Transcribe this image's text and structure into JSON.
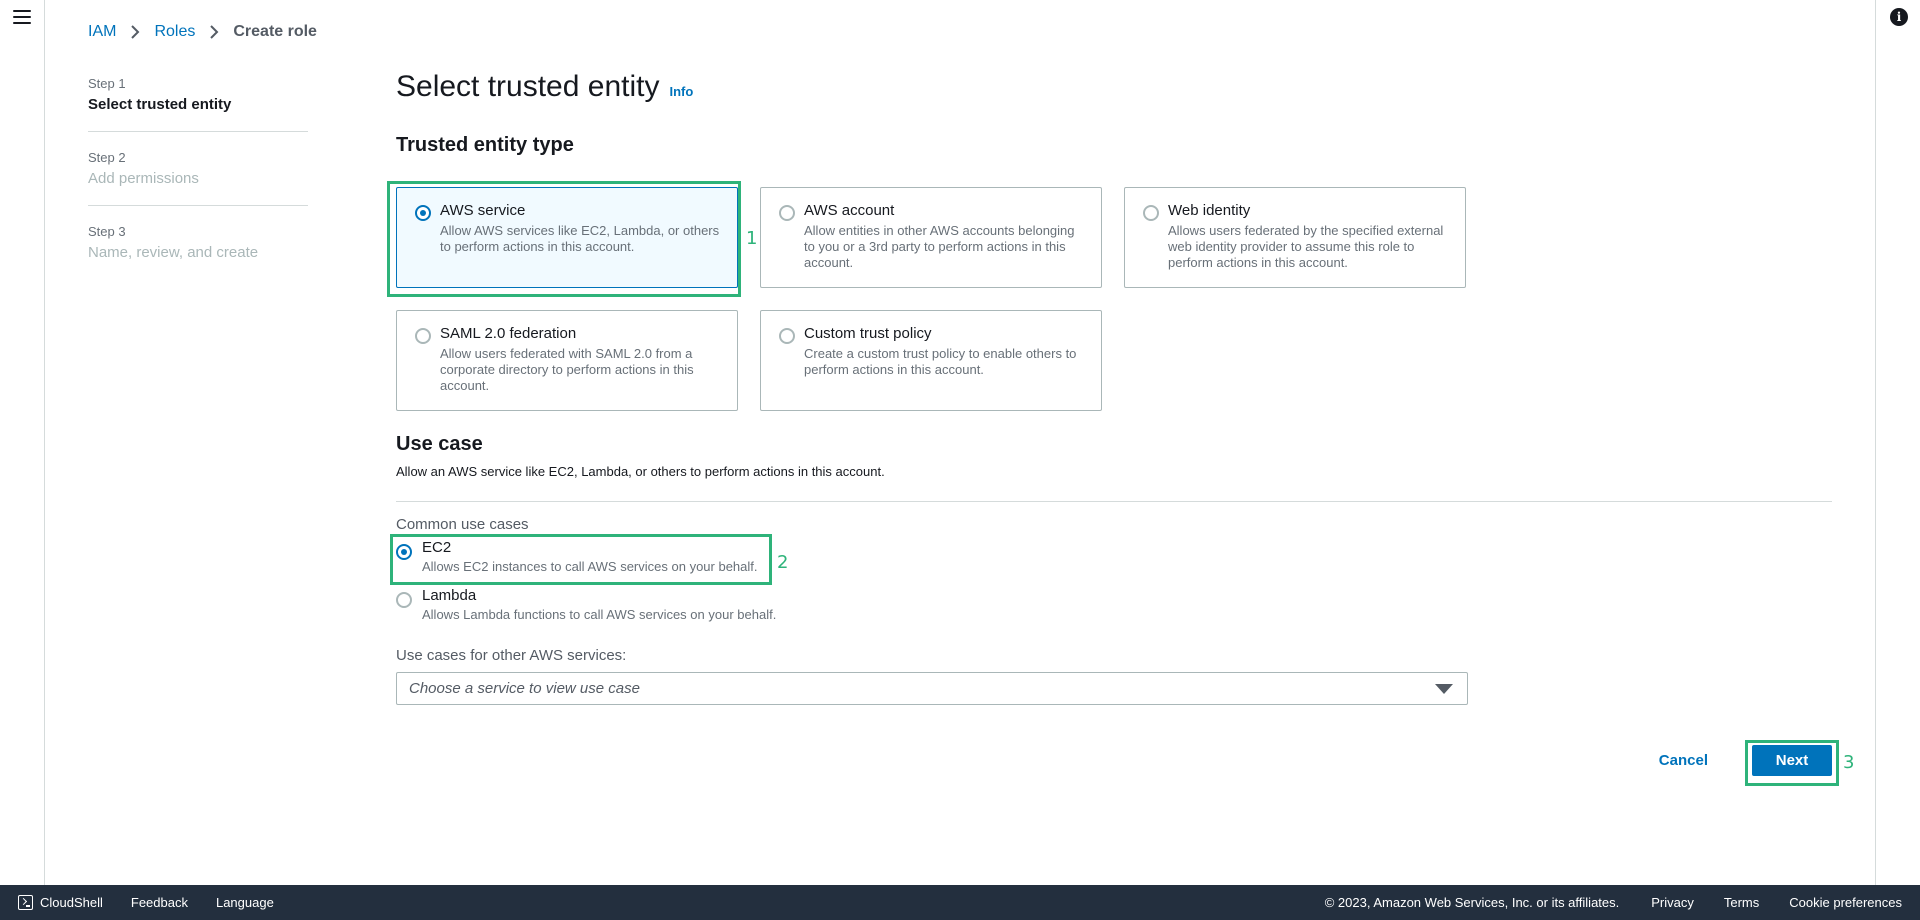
{
  "breadcrumb": {
    "items": [
      "IAM",
      "Roles"
    ],
    "current": "Create role"
  },
  "steps": [
    {
      "num": "Step 1",
      "title": "Select trusted entity",
      "active": true
    },
    {
      "num": "Step 2",
      "title": "Add permissions",
      "active": false
    },
    {
      "num": "Step 3",
      "title": "Name, review, and create",
      "active": false
    }
  ],
  "main": {
    "title": "Select trusted entity",
    "info": "Info",
    "trusted_entity_type": {
      "title": "Trusted entity type",
      "tiles": [
        {
          "title": "AWS service",
          "desc": "Allow AWS services like EC2, Lambda, or others to perform actions in this account.",
          "selected": true
        },
        {
          "title": "AWS account",
          "desc": "Allow entities in other AWS accounts belonging to you or a 3rd party to perform actions in this account.",
          "selected": false
        },
        {
          "title": "Web identity",
          "desc": "Allows users federated by the specified external web identity provider to assume this role to perform actions in this account.",
          "selected": false
        },
        {
          "title": "SAML 2.0 federation",
          "desc": "Allow users federated with SAML 2.0 from a corporate directory to perform actions in this account.",
          "selected": false
        },
        {
          "title": "Custom trust policy",
          "desc": "Create a custom trust policy to enable others to perform actions in this account.",
          "selected": false
        }
      ]
    },
    "use_case": {
      "title": "Use case",
      "desc": "Allow an AWS service like EC2, Lambda, or others to perform actions in this account.",
      "common_label": "Common use cases",
      "options": [
        {
          "title": "EC2",
          "desc": "Allows EC2 instances to call AWS services on your behalf.",
          "selected": true
        },
        {
          "title": "Lambda",
          "desc": "Allows Lambda functions to call AWS services on your behalf.",
          "selected": false
        }
      ],
      "other_label": "Use cases for other AWS services:",
      "select_placeholder": "Choose a service to view use case"
    },
    "cancel_label": "Cancel",
    "next_label": "Next"
  },
  "annotations": [
    "1",
    "2",
    "3"
  ],
  "footer": {
    "cloudshell": "CloudShell",
    "feedback": "Feedback",
    "language": "Language",
    "copyright": "© 2023, Amazon Web Services, Inc. or its affiliates.",
    "privacy": "Privacy",
    "terms": "Terms",
    "cookies": "Cookie preferences"
  },
  "colors": {
    "link": "#0073bb",
    "highlight": "#2eb37a",
    "footer_bg": "#232f3e"
  },
  "icons": [
    "menu-icon",
    "info-icon",
    "chevron-right-icon",
    "caret-down-icon",
    "cloudshell-icon"
  ]
}
